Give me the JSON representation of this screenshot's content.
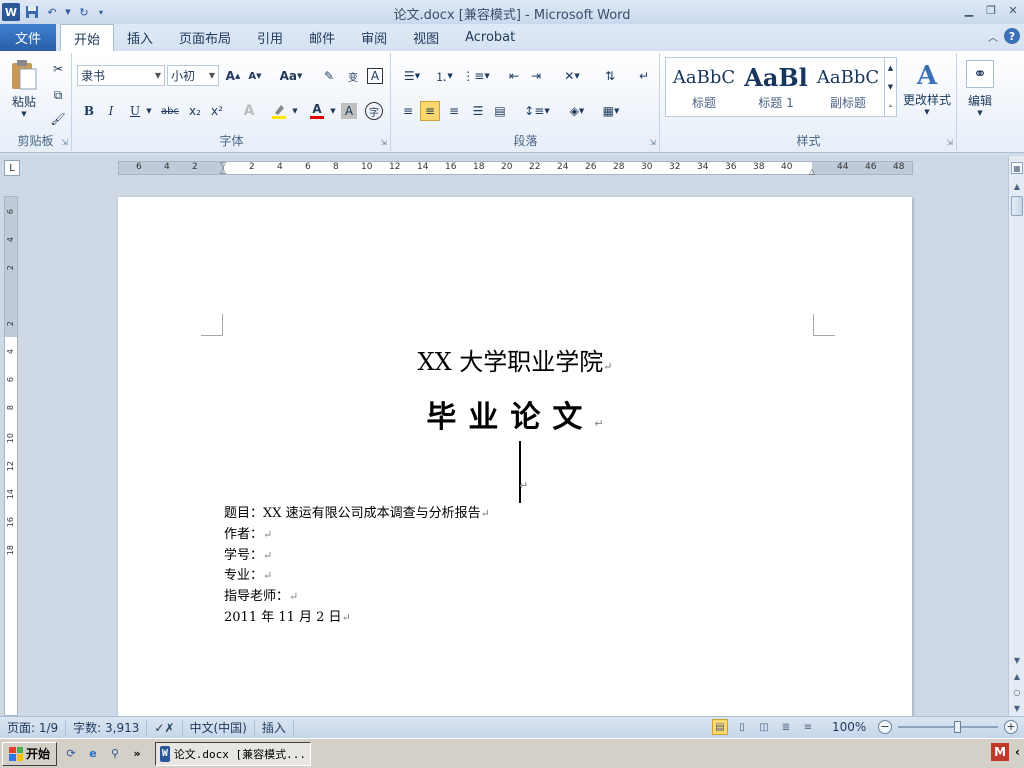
{
  "window": {
    "title": "论文.docx [兼容模式] - Microsoft Word"
  },
  "tabs": [
    {
      "label": "文件"
    },
    {
      "label": "开始"
    },
    {
      "label": "插入"
    },
    {
      "label": "页面布局"
    },
    {
      "label": "引用"
    },
    {
      "label": "邮件"
    },
    {
      "label": "审阅"
    },
    {
      "label": "视图"
    },
    {
      "label": "Acrobat"
    }
  ],
  "ribbon": {
    "clipboard": {
      "paste_label": "粘贴",
      "group_label": "剪贴板"
    },
    "font": {
      "font_name": "隶书",
      "font_size": "小初",
      "group_label": "字体",
      "grow": "A",
      "shrink": "A",
      "case": "Aa",
      "bold": "B",
      "italic": "I",
      "underline": "U",
      "strike": "abc",
      "subscript": "x₂",
      "superscript": "x²",
      "color_a": "A",
      "shade_a": "A",
      "char_border": "A",
      "enclose": "字",
      "pinyin": "wén",
      "char_border2": "变"
    },
    "paragraph": {
      "group_label": "段落"
    },
    "styles": {
      "group_label": "样式",
      "items": [
        {
          "preview": "AaBbC",
          "label": "标题"
        },
        {
          "preview": "AaBl",
          "label": "标题 1"
        },
        {
          "preview": "AaBbC",
          "label": "副标题"
        }
      ],
      "change_styles": "更改样式"
    },
    "editing": {
      "label": "编辑"
    }
  },
  "ruler": {
    "h_numbers": [
      "6",
      "4",
      "2",
      "2",
      "4",
      "6",
      "8",
      "10",
      "12",
      "14",
      "16",
      "18",
      "20",
      "22",
      "24",
      "26",
      "28",
      "30",
      "32",
      "34",
      "36",
      "38",
      "40",
      "44",
      "46",
      "48"
    ],
    "v_numbers": [
      "6",
      "4",
      "2",
      "2",
      "4",
      "6",
      "8",
      "10",
      "12",
      "14",
      "16",
      "18"
    ]
  },
  "document": {
    "title1": "XX 大学职业学院",
    "title2": "毕业论文",
    "lines": [
      "题目：XX 速运有限公司成本调查与分析报告",
      "作者：",
      "学号：",
      "专业：",
      "指导老师：",
      "2011 年 11 月 2 日"
    ],
    "para_mark": "↵"
  },
  "statusbar": {
    "page": "页面: 1/9",
    "words": "字数: 3,913",
    "language": "中文(中国)",
    "mode": "插入",
    "zoom": "100%",
    "zoom_level": 1.0
  },
  "taskbar": {
    "start": "开始",
    "task_label": "论文.docx [兼容模式..."
  },
  "colors": {
    "file_tab": "#2a5fa8",
    "word_blue": "#2b5797",
    "active_view": "#fbd86d"
  }
}
